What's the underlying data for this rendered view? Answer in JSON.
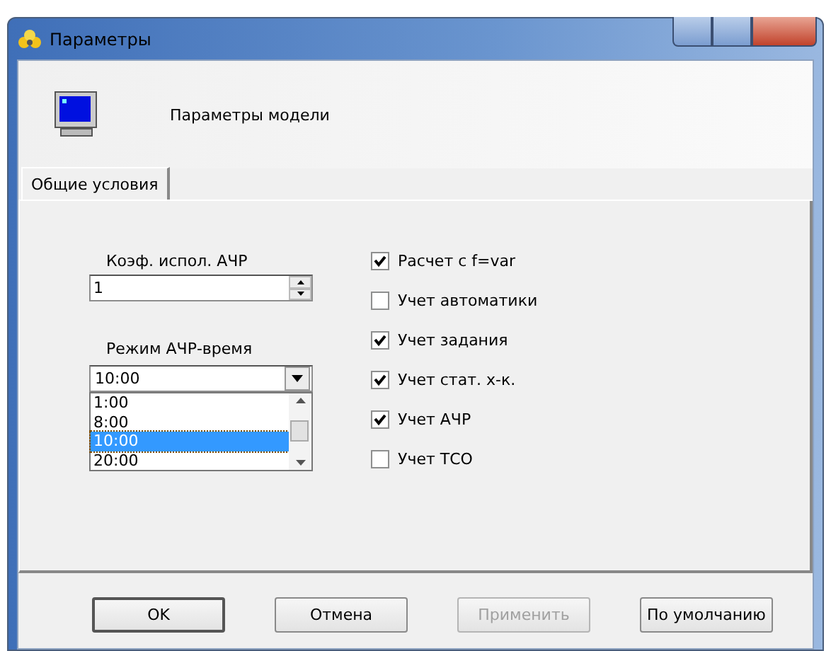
{
  "window": {
    "title": "Параметры"
  },
  "header": {
    "title": "Параметры модели"
  },
  "tabs": [
    {
      "label": "Общие условия",
      "selected": true
    }
  ],
  "coef": {
    "label": "Коэф. испол. АЧР",
    "value": "1"
  },
  "mode": {
    "label": "Режим АЧР-время",
    "value": "10:00",
    "options": [
      {
        "label": "1:00",
        "selected": false
      },
      {
        "label": "8:00",
        "selected": false
      },
      {
        "label": "10:00",
        "selected": true
      },
      {
        "label": "20:00",
        "selected": false
      }
    ]
  },
  "checkboxes": [
    {
      "label": "Расчет с f=var",
      "checked": true
    },
    {
      "label": "Учет автоматики",
      "checked": false
    },
    {
      "label": "Учет задания",
      "checked": true
    },
    {
      "label": "Учет стат. х-к.",
      "checked": true
    },
    {
      "label": "Учет АЧР",
      "checked": true
    },
    {
      "label": "Учет ТСО",
      "checked": false
    }
  ],
  "buttons": [
    {
      "label": "OK",
      "disabled": false,
      "default": true
    },
    {
      "label": "Отмена",
      "disabled": false,
      "default": false
    },
    {
      "label": "Применить",
      "disabled": true,
      "default": false
    },
    {
      "label": "По умолчанию",
      "disabled": false,
      "default": false
    }
  ]
}
